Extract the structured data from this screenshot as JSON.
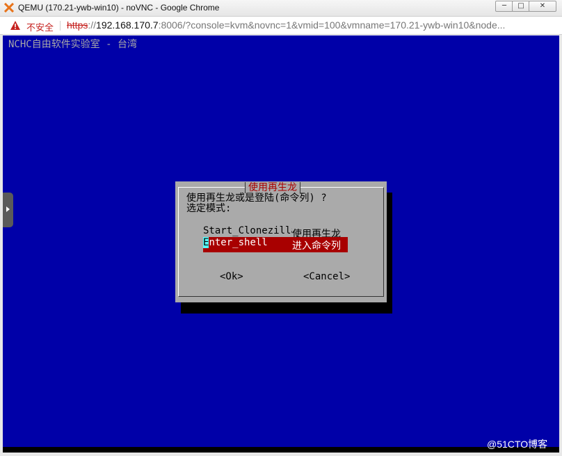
{
  "window": {
    "title": "QEMU (170.21-ywb-win10) - noVNC - Google Chrome",
    "minimize_label": "─",
    "maximize_label": "□",
    "close_label": "✕"
  },
  "addressbar": {
    "security_label": "不安全",
    "url_scheme": "https",
    "url_sep": "://",
    "url_host": "192.168.170.7",
    "url_rest": ":8006/?console=kvm&novnc=1&vmid=100&vmname=170.21-ywb-win10&node..."
  },
  "console": {
    "header": "NCHC自由软件实验室 - 台湾",
    "background_color": "#0000a8",
    "dialog": {
      "title": "使用再生龙",
      "prompt_line1": "使用再生龙或是登陆(命令列) ?",
      "prompt_line2": "选定模式:",
      "items": [
        {
          "tag": "Start_Clonezilla",
          "description": "使用再生龙"
        },
        {
          "tag_first_char": "E",
          "tag_rest": "nter_shell",
          "description": "进入命令列"
        }
      ],
      "selected_item_index": 1,
      "ok_label": "<Ok>",
      "cancel_label": "<Cancel>"
    }
  },
  "watermark": "@51CTO博客"
}
